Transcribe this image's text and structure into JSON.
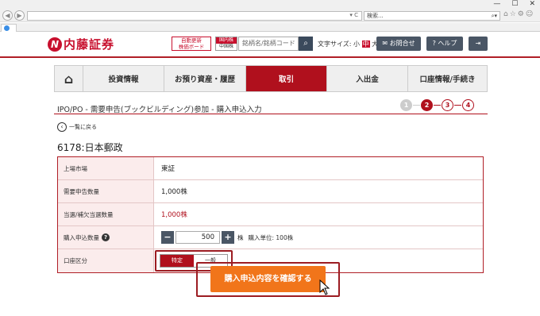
{
  "browser": {
    "search_placeholder": "検索...",
    "win_minimize": "—",
    "win_maximize": "☐",
    "win_close": "✕"
  },
  "header": {
    "logo_text": "内藤証券",
    "logo_mark": "N",
    "auto_update_line1": "自動更新",
    "auto_update_line2": "株価ボード",
    "market_top": "国内株",
    "market_bottom": "中国株",
    "code_placeholder": "銘柄名/銘柄コード",
    "font_size_label": "文字サイズ:",
    "font_small": "小",
    "font_medium": "中",
    "font_large": "大",
    "contact_label": "お問合せ",
    "help_label": "ヘルプ"
  },
  "nav": {
    "items": [
      "投資情報",
      "お預り資産・履歴",
      "取引",
      "入出金",
      "口座情報/手続き"
    ],
    "active": "取引"
  },
  "page": {
    "title": "IPO/PO - 需要申告(ブックビルディング)参加 - 購入申込入力",
    "steps": [
      "1",
      "2",
      "3",
      "4"
    ],
    "current_step": 2,
    "back_label": "一覧に戻る",
    "stock_name": "6178:日本郵政"
  },
  "form": {
    "rows": [
      {
        "label": "上場市場",
        "value": "東証"
      },
      {
        "label": "需要申告数量",
        "value": "1,000株"
      },
      {
        "label": "当選/補欠当選数量",
        "value": "1,000株"
      },
      {
        "label": "購入申込数量"
      },
      {
        "label": "口座区分"
      }
    ],
    "quantity_value": "500",
    "quantity_unit": "株",
    "quantity_minus": "−",
    "quantity_plus": "+",
    "purchase_unit_label": "購入単位: 100株",
    "account_options": [
      "特定",
      "一般"
    ],
    "account_selected": "特定"
  },
  "confirm_button_label": "購入申込内容を確認する",
  "colors": {
    "brand_red": "#c8102e",
    "nav_active": "#b0101d",
    "confirm_orange": "#f1751a"
  }
}
